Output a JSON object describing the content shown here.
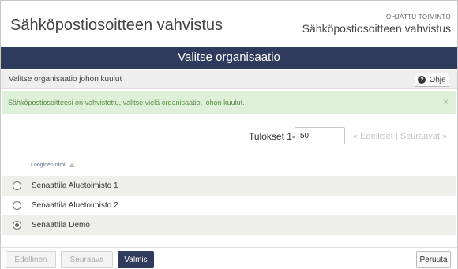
{
  "header": {
    "title": "Sähköpostiosoitteen vahvistus",
    "guided_label": "OHJATTU TOIMINTO",
    "guided_title": "Sähköpostiosoitteen vahvistus"
  },
  "navbar": {
    "title": "Valitse organisaatio"
  },
  "subheader": {
    "text": "Valitse organisaatio johon kuulut",
    "help_label": "Ohje"
  },
  "alert": {
    "text": "Sähköpostiosoitteesi on vahvistettu, valitse vielä organisaatio, johon kuulut.",
    "close": "×"
  },
  "results": {
    "label": "Tulokset 1-3",
    "page_size": "50",
    "prev": "« Edelliset",
    "separator": "|",
    "next": "Seuraavat »"
  },
  "table": {
    "column_header": "Looginen nimi",
    "rows": [
      {
        "label": "Senaattila Aluetoimisto 1",
        "selected": false
      },
      {
        "label": "Senaattila Aluetoimisto 2",
        "selected": false
      },
      {
        "label": "Senaattila Demo",
        "selected": true
      }
    ]
  },
  "footer": {
    "prev_label": "Edellinen",
    "next_label": "Seuraava",
    "done_label": "Valmis",
    "cancel_label": "Peruuta"
  },
  "colors": {
    "navbar": "#2f3b5c",
    "alert_bg": "#dff0d8",
    "alert_text": "#5a8a4a"
  }
}
